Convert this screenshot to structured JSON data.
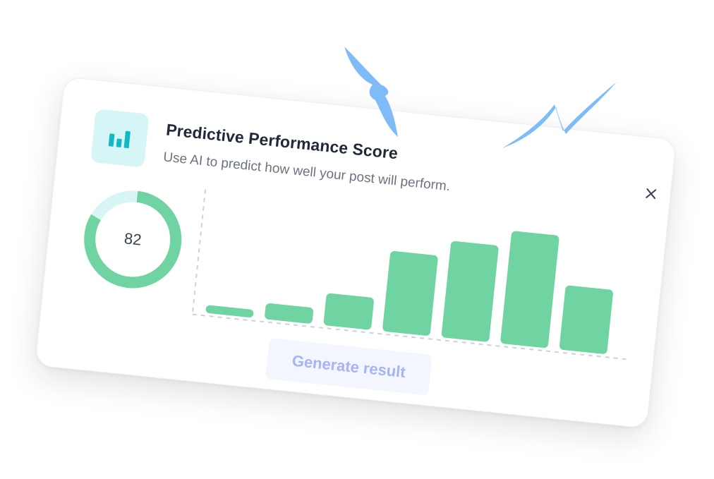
{
  "card": {
    "title": "Predictive Performance Score",
    "subtitle": "Use AI to predict how well your post will perform.",
    "icon": "bar-chart-icon",
    "close_icon": "close-icon"
  },
  "score": {
    "value": "82",
    "fraction": 0.82,
    "ring_color": "#6fd4a1",
    "track_color": "#d6f5f4"
  },
  "chart_data": {
    "type": "bar",
    "values": [
      1,
      2,
      4,
      10,
      12,
      14,
      8
    ],
    "ylim": [
      0,
      15
    ],
    "bar_color": "#6fd4a1",
    "grid": false
  },
  "actions": {
    "generate_label": "Generate result"
  },
  "colors": {
    "icon_tile": "#d6f5f6",
    "icon": "#12b8c4",
    "lightning": "#7fbcf7",
    "title": "#1f2937",
    "subtitle": "#6b7280"
  }
}
